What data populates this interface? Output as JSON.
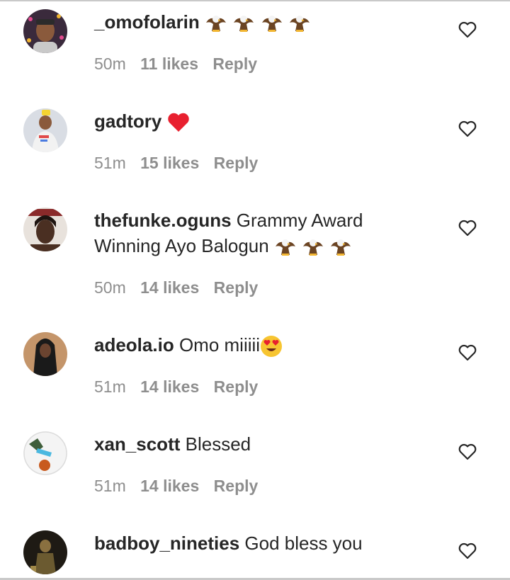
{
  "comments": [
    {
      "username": "_omofolarin",
      "text": "",
      "emoji": "eagle",
      "emoji_count": 4,
      "time": "50m",
      "likes": "11 likes",
      "reply": "Reply"
    },
    {
      "username": "gadtory",
      "text": "",
      "emoji": "heart",
      "emoji_count": 1,
      "time": "51m",
      "likes": "15 likes",
      "reply": "Reply"
    },
    {
      "username": "thefunke.oguns",
      "text": "Grammy Award Winning Ayo Balogun",
      "emoji": "eagle",
      "emoji_count": 3,
      "time": "50m",
      "likes": "14 likes",
      "reply": "Reply"
    },
    {
      "username": "adeola.io",
      "text": "Omo miiiii",
      "emoji": "heart-eyes",
      "emoji_count": 1,
      "time": "51m",
      "likes": "14 likes",
      "reply": "Reply"
    },
    {
      "username": "xan_scott",
      "text": "Blessed",
      "emoji": "",
      "emoji_count": 0,
      "time": "51m",
      "likes": "14 likes",
      "reply": "Reply"
    },
    {
      "username": "badboy_nineties",
      "text": "God bless you",
      "emoji": "",
      "emoji_count": 0,
      "time": "",
      "likes": "",
      "reply": ""
    }
  ],
  "colors": {
    "text": "#262626",
    "meta": "#8e8e8e",
    "heart_red": "#e8202f"
  }
}
